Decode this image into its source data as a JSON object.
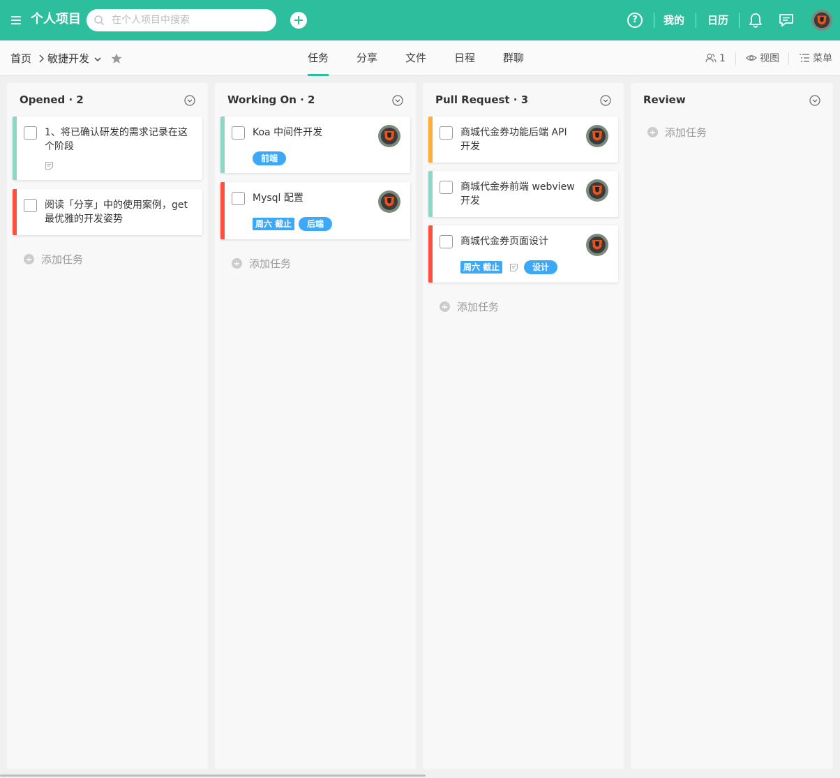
{
  "header": {
    "app_title": "个人项目",
    "search_placeholder": "在个人项目中搜索",
    "help": "?",
    "mine": "我的",
    "calendar": "日历"
  },
  "subnav": {
    "home": "首页",
    "project": "敏捷开发",
    "tabs": [
      "任务",
      "分享",
      "文件",
      "日程",
      "群聊"
    ],
    "members_count": "1",
    "view": "视图",
    "menu": "菜单"
  },
  "colors": {
    "brand": "#2dbe9e",
    "priority_green": "#8fd6c6",
    "priority_red": "#ff4f3e",
    "priority_orange": "#ffaf38",
    "tag_blue": "#3da8f5"
  },
  "columns": [
    {
      "title": "Opened · 2",
      "add_label": "添加任务",
      "cards": [
        {
          "text": [
            "1、将已确认研发的需求记录在这",
            "个阶段"
          ],
          "priority": "green",
          "has_note": true
        },
        {
          "text": [
            "阅读「分享」中的使用案例，get",
            "最优雅的开发姿势"
          ],
          "priority": "red"
        }
      ]
    },
    {
      "title": "Working On · 2",
      "add_label": "添加任务",
      "cards": [
        {
          "text": [
            "Koa 中间件开发"
          ],
          "priority": "green",
          "tags": [
            "前端"
          ],
          "avatar": true
        },
        {
          "text": [
            "Mysql 配置"
          ],
          "priority": "red",
          "due": "周六 截止",
          "tags": [
            "后端"
          ],
          "avatar": true
        }
      ]
    },
    {
      "title": "Pull Request · 3",
      "add_label": "添加任务",
      "cards": [
        {
          "text": [
            "商城代金券功能后端 API",
            "开发"
          ],
          "priority": "orange",
          "avatar": true
        },
        {
          "text": [
            "商城代金券前端 webview",
            "开发"
          ],
          "priority": "green",
          "avatar": true
        },
        {
          "text": [
            "商城代金券页面设计"
          ],
          "priority": "red",
          "due": "周六 截止",
          "has_note": true,
          "tags": [
            "设计"
          ],
          "avatar": true
        }
      ]
    },
    {
      "title": "Review",
      "add_label": "添加任务",
      "cards": []
    }
  ]
}
